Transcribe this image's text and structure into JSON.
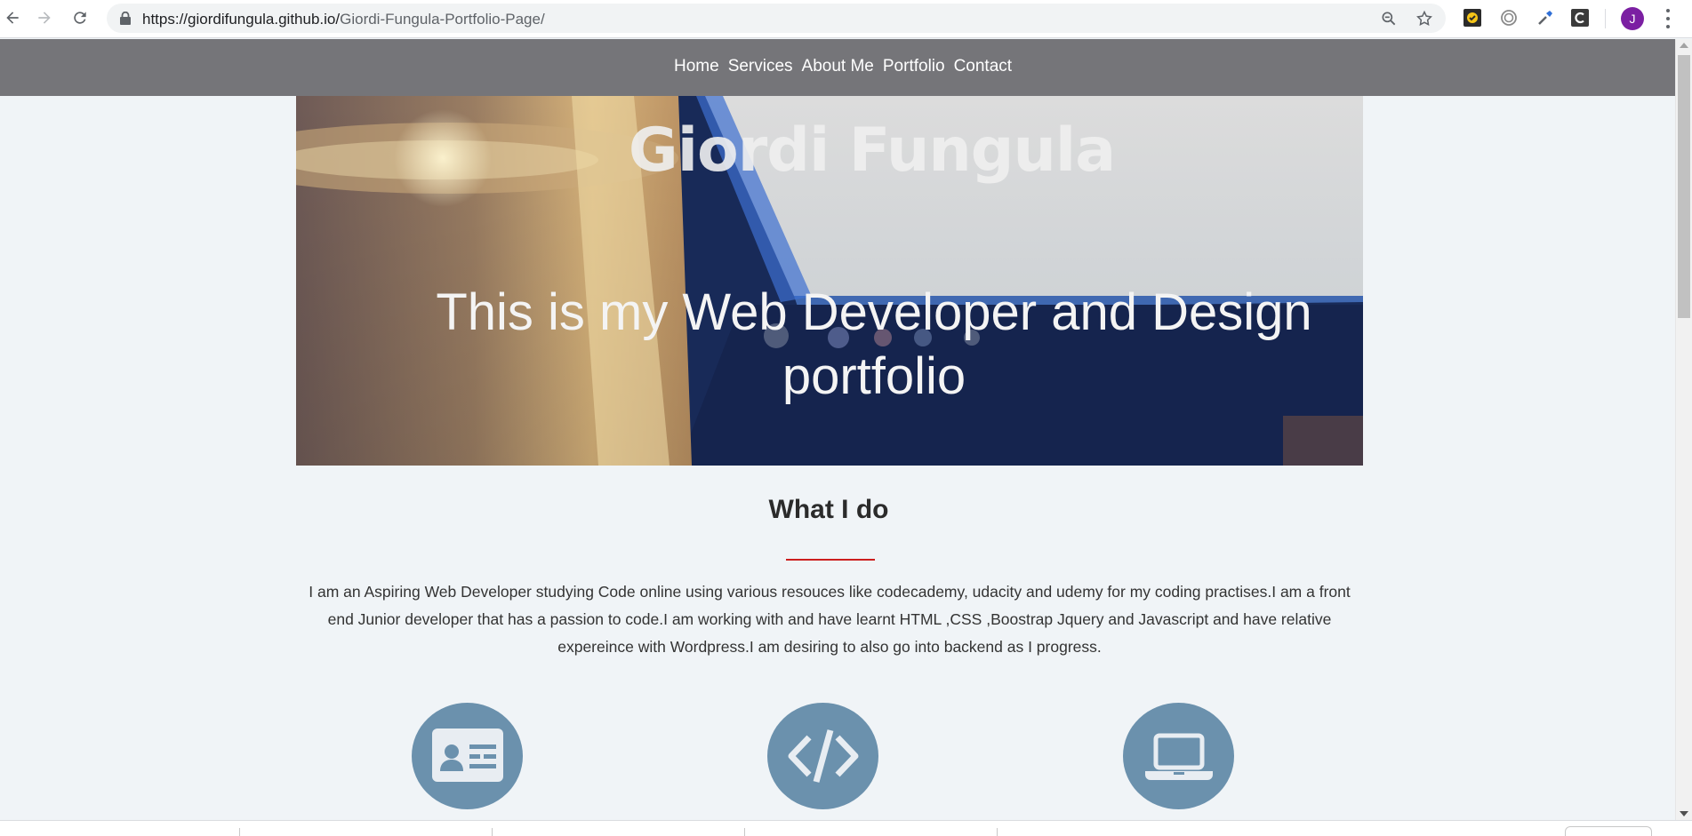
{
  "browser": {
    "url_host": "https://giordifungula.github.io/",
    "url_path": "Giordi-Fungula-Portfolio-Page/",
    "profile_initial": "J",
    "icons": [
      "back-icon",
      "forward-icon",
      "reload-icon",
      "lock-icon",
      "zoom-icon",
      "star-icon",
      "extension-check-icon",
      "extension-fingerprint-icon",
      "extension-eyedropper-icon",
      "extension-c-icon",
      "menu-kebab-icon"
    ]
  },
  "site": {
    "nav": [
      "Home",
      "Services",
      "About Me",
      "Portfolio",
      "Contact"
    ],
    "hero_title": "Giordi Fungula",
    "hero_subtitle": "This is my Web Developer and Design portfolio",
    "section_title": "What I do",
    "intro": "I am an Aspiring Web Developer studying Code online using various resouces like codecademy, udacity and udemy for my coding practises.I am a front end Junior developer that has a passion to code.I am working with and have learnt HTML ,CSS ,Boostrap Jquery and Javascript and have relative expereince with Wordpress.I am desiring to also go into backend as I progress.",
    "services": [
      {
        "icon": "id-card-icon"
      },
      {
        "icon": "code-icon"
      },
      {
        "icon": "laptop-icon"
      }
    ]
  },
  "colors": {
    "nav_bg": "#757579",
    "page_bg": "#f0f4f7",
    "accent_rule": "#cc1e1e",
    "icon_circle": "#6b91ad"
  }
}
